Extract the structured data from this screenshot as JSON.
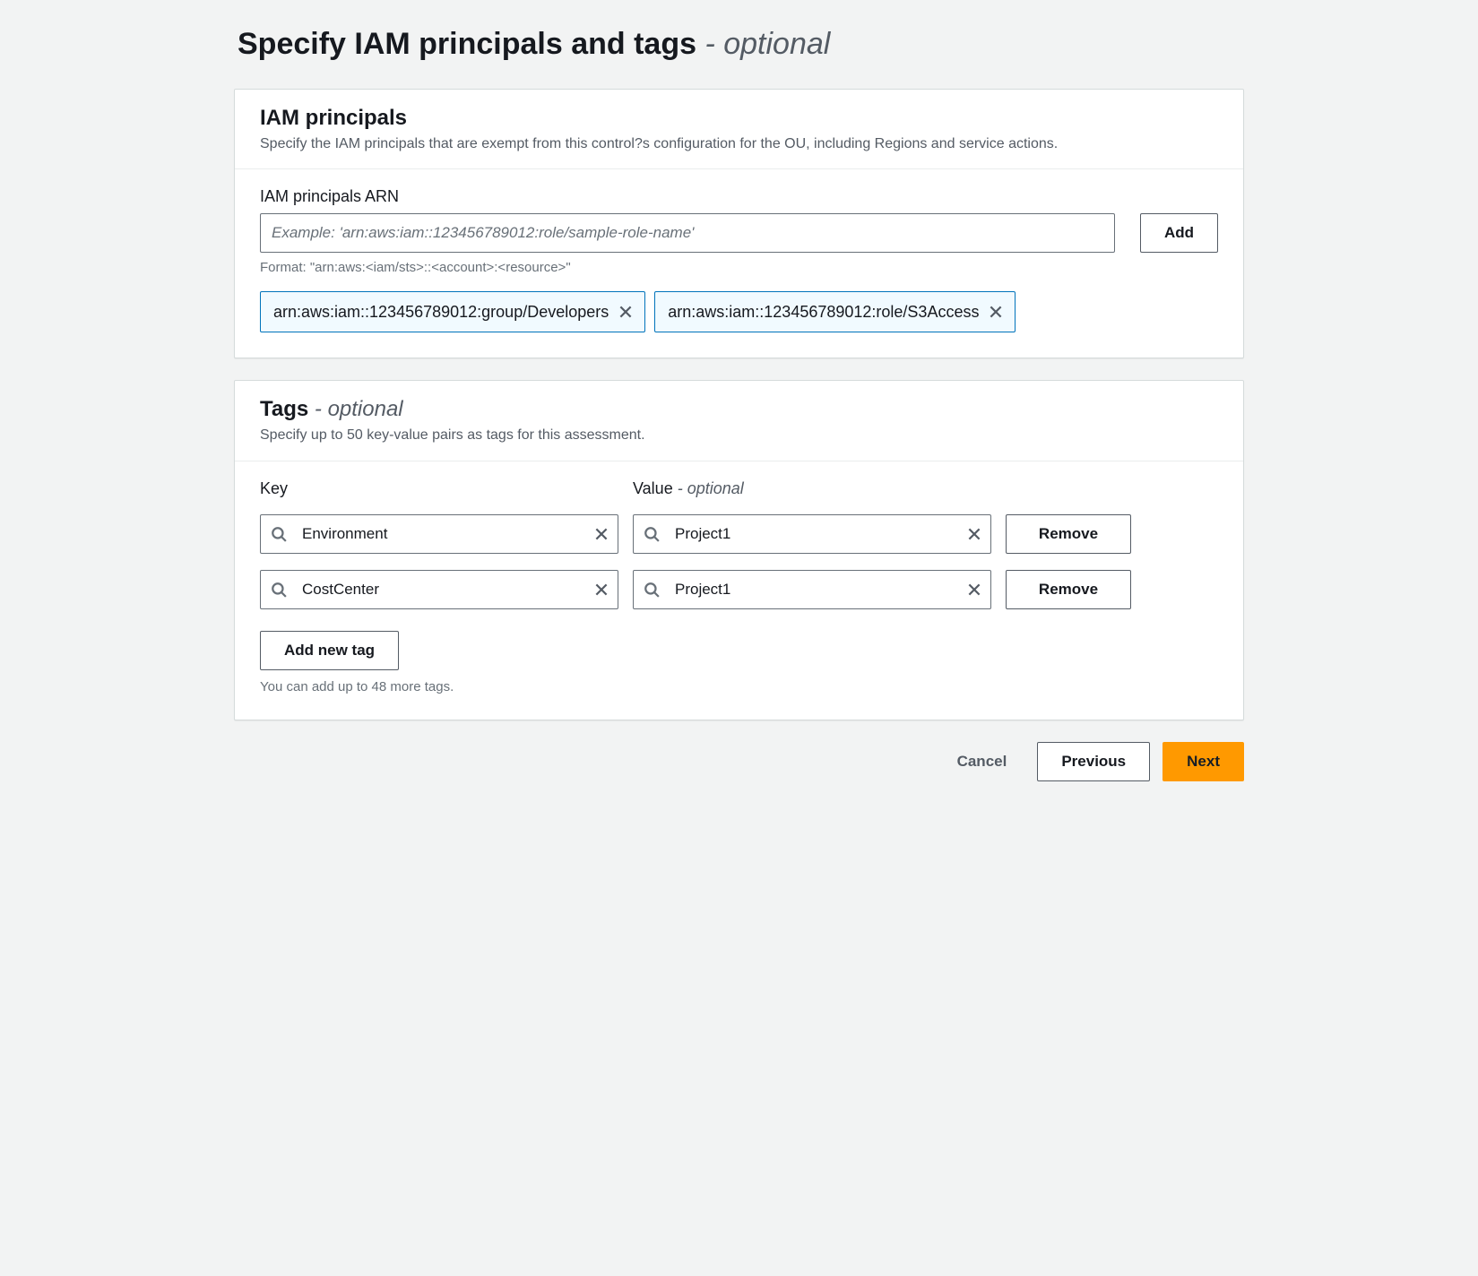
{
  "page": {
    "title": "Specify IAM principals and tags",
    "title_suffix": " - optional"
  },
  "iam": {
    "heading": "IAM principals",
    "desc": "Specify the IAM principals that are exempt from this control?s configuration for the OU, including Regions and service actions.",
    "field_label": "IAM principals ARN",
    "placeholder": "Example: 'arn:aws:iam::123456789012:role/sample-role-name'",
    "add_label": "Add",
    "format_hint": "Format: \"arn:aws:<iam/sts>::<account>:<resource>\"",
    "tokens": [
      "arn:aws:iam::123456789012:group/Developers",
      "arn:aws:iam::123456789012:role/S3Access"
    ]
  },
  "tags": {
    "heading": "Tags",
    "heading_suffix": " - optional",
    "desc": "Specify up to 50 key-value pairs as tags for this assessment.",
    "key_label": "Key",
    "value_label": "Value",
    "value_suffix": " - optional",
    "remove_label": "Remove",
    "add_new_label": "Add new tag",
    "footer_hint": "You can add up to 48 more tags.",
    "rows": [
      {
        "key": "Environment",
        "value": "Project1"
      },
      {
        "key": "CostCenter",
        "value": "Project1"
      }
    ]
  },
  "footer": {
    "cancel": "Cancel",
    "previous": "Previous",
    "next": "Next"
  }
}
